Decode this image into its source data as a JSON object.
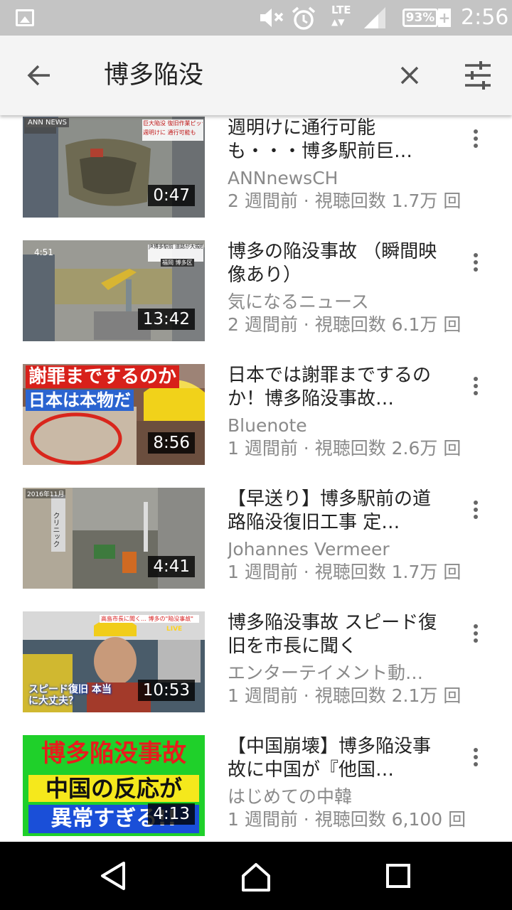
{
  "status_bar": {
    "time": "2:56",
    "battery": "93%",
    "battery_charging_symbol": "+",
    "network": "LTE",
    "icons": [
      "gallery-icon",
      "mute-icon",
      "alarm-icon",
      "lte-icon",
      "signal-icon",
      "battery-icon"
    ]
  },
  "toolbar": {
    "query": "博多陥没",
    "icons": [
      "back-arrow-icon",
      "clear-icon",
      "filter-icon"
    ]
  },
  "results": [
    {
      "title": "週明けに通行可能も・・・博多駅前巨…",
      "channel": "ANNnewsCH",
      "meta": "2 週間前 · 視聴回数 1.7万 回",
      "duration": "0:47",
      "overlay_texts": [
        "ANN NEWS",
        "巨大陥没 復旧作業ピッチ",
        "週明けに 通行可能も"
      ]
    },
    {
      "title": "博多の陥没事故 （瞬間映像あり）",
      "channel": "気になるニュース",
      "meta": "2 週間前 · 視聴回数 6.1万 回",
      "duration": "13:42",
      "overlay_texts": [
        "4:51",
        "JR博多駅前 道路が大規模陥没",
        "福岡 博多区"
      ]
    },
    {
      "title": "日本では謝罪までするのか！博多陥没事故…",
      "channel": "Bluenote",
      "meta": "1 週間前 · 視聴回数 2.6万 回",
      "duration": "8:56",
      "overlay_texts": [
        "謝罪までするのか",
        "日本は本物だ"
      ]
    },
    {
      "title": "【早送り】博多駅前の道路陥没復旧工事 定…",
      "channel": "Johannes Vermeer",
      "meta": "1 週間前 · 視聴回数 1.7万 回",
      "duration": "4:41",
      "overlay_texts": [
        "2016年11月",
        "クリニック"
      ]
    },
    {
      "title": "博多陥没事故 スピード復旧を市長に聞く",
      "channel": "エンターテイメント動…",
      "meta": "1 週間前 · 視聴回数 2.1万 回",
      "duration": "10:53",
      "overlay_texts": [
        "高島市長に聞く… 博多の\"陥没事故\"",
        "LIVE",
        "スピード復旧 本当に大丈夫？"
      ]
    },
    {
      "title": "【中国崩壊】博多陥没事故に中国が『他国…",
      "channel": "はじめての中韓",
      "meta": "1 週間前 · 視聴回数 6,100 回",
      "duration": "4:13",
      "overlay_texts": [
        "博多陥没事故",
        "中国の反応が",
        "異常すぎる!!"
      ]
    }
  ],
  "nav_bar": {
    "icons": [
      "back-triangle-icon",
      "home-icon",
      "recents-icon"
    ]
  }
}
